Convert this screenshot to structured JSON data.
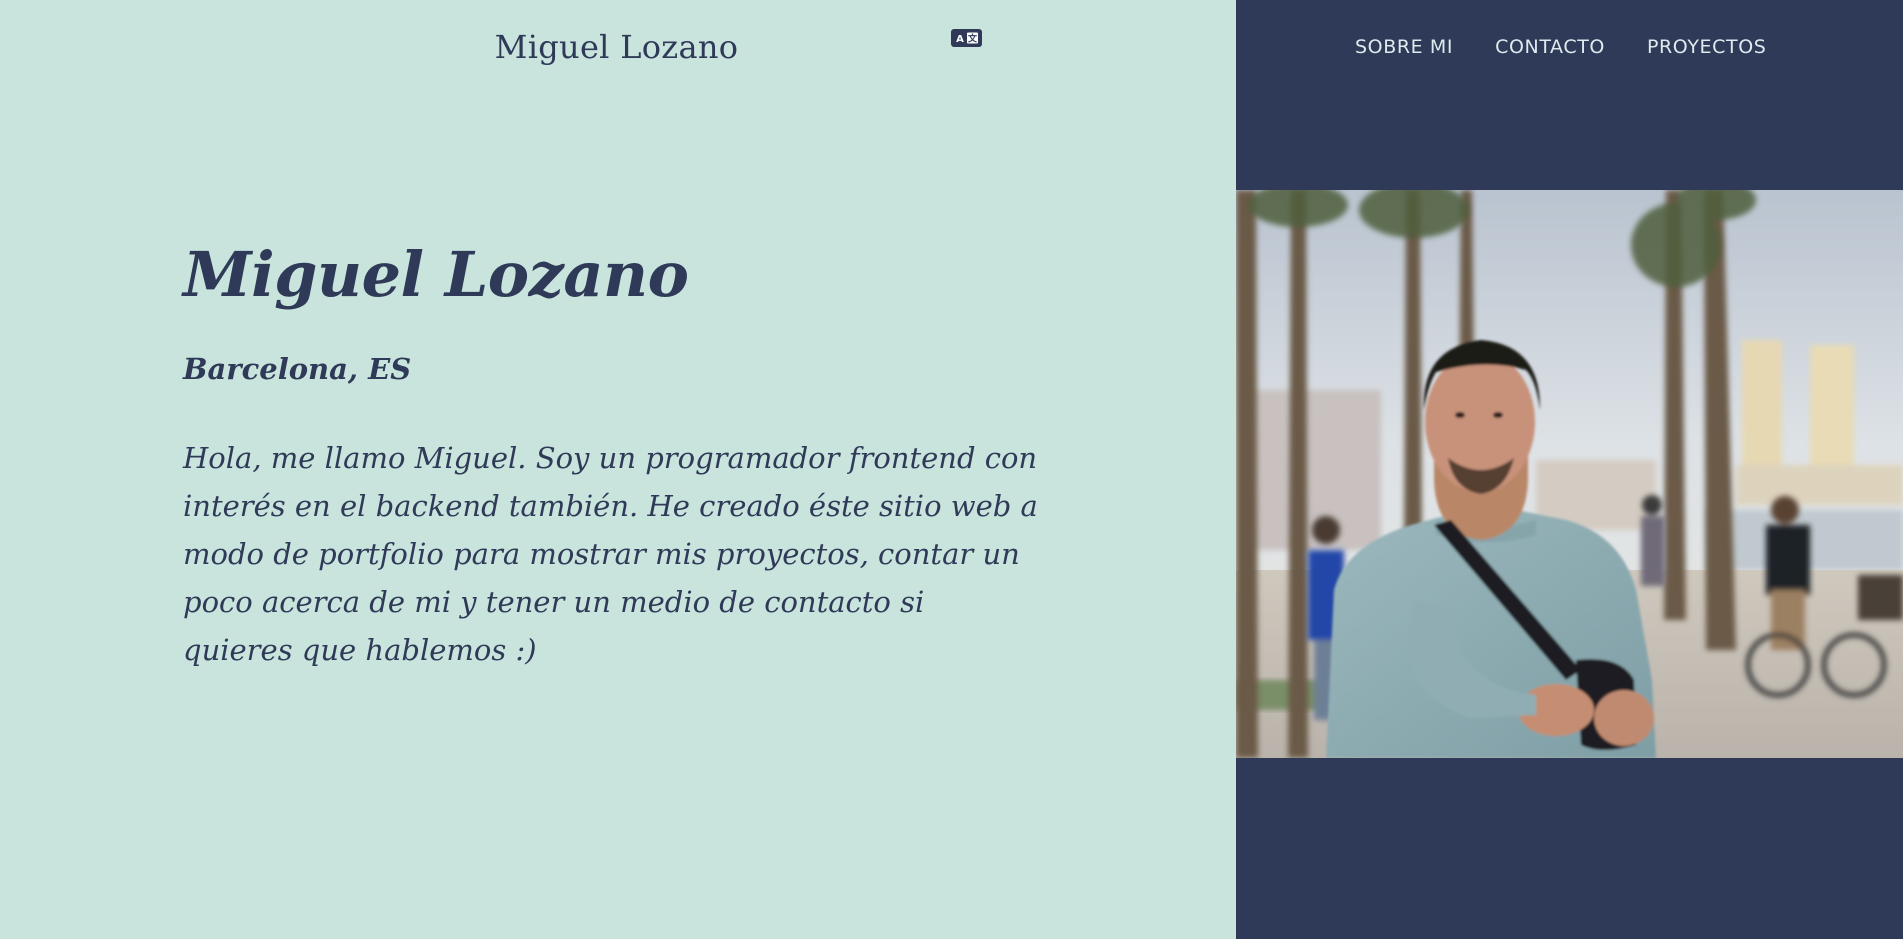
{
  "header": {
    "site_title": "Miguel Lozano",
    "translate_icon": "translate-icon"
  },
  "nav": {
    "items": [
      {
        "label": "SOBRE MI"
      },
      {
        "label": "CONTACTO"
      },
      {
        "label": "PROYECTOS"
      }
    ]
  },
  "hero": {
    "name": "Miguel Lozano",
    "location": "Barcelona, ES",
    "bio": "Hola, me llamo Miguel. Soy un programador frontend con interés en el backend también. He creado éste sitio web a modo de portfolio para mostrar mis proyectos, contar un poco acerca de mi y tener un medio de contacto si quieres que hablemos :)"
  },
  "colors": {
    "left_background": "#c9e4dd",
    "right_background": "#2e3a57",
    "text": "#2e3a57",
    "nav_text": "#dfe9ee"
  }
}
